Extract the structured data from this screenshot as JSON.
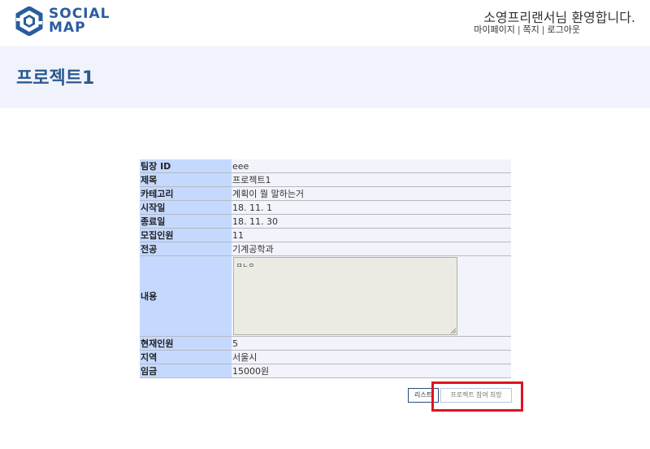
{
  "header": {
    "logo_line1": "SOCIAL",
    "logo_line2": "MAP",
    "welcome": "소영프리랜서님 환영합니다.",
    "nav": [
      "마이페이지",
      "쪽지",
      "로그아웃"
    ],
    "separator": "|"
  },
  "page": {
    "title": "프로젝트1"
  },
  "detail": {
    "rows": [
      {
        "label": "팀장 ID",
        "value": "eee"
      },
      {
        "label": "제목",
        "value": "프로젝트1"
      },
      {
        "label": "카테고리",
        "value": "계획이 뭘 말하는거"
      },
      {
        "label": "시작일",
        "value": "18. 11. 1"
      },
      {
        "label": "종료일",
        "value": "18. 11. 30"
      },
      {
        "label": "모집인원",
        "value": "11"
      },
      {
        "label": "전공",
        "value": "기계공학과"
      }
    ],
    "content_label": "내용",
    "content_value": "ㅁㄴㅇ",
    "rows_after": [
      {
        "label": "현재인원",
        "value": "5"
      },
      {
        "label": "지역",
        "value": "서울시"
      },
      {
        "label": "임금",
        "value": "15000원"
      }
    ]
  },
  "buttons": {
    "list": "리스트",
    "join": "프로젝트 참여 희망"
  },
  "colors": {
    "brand": "#2a5d9f",
    "title": "#2b5a8f",
    "label_bg": "#c5d9fe",
    "band_bg": "#f1f3fc",
    "highlight": "#e0131f"
  }
}
